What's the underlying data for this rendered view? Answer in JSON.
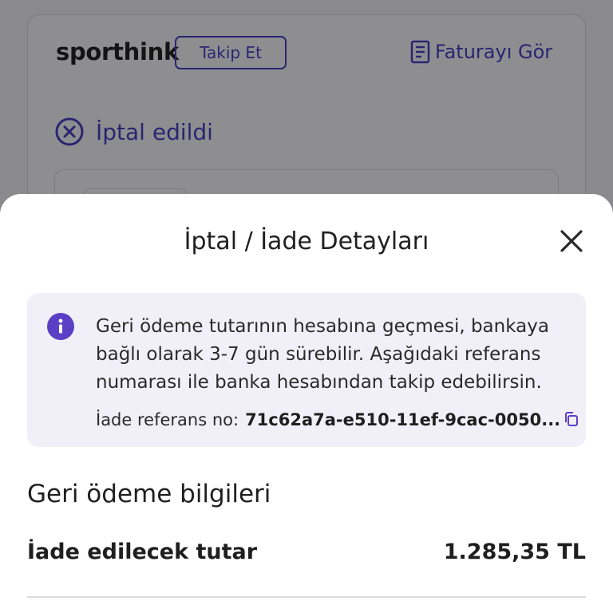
{
  "background": {
    "store_name": "sporthink",
    "follow_label": "Takip Et",
    "invoice_label": "Faturayı Gör",
    "status_text": "İptal edildi"
  },
  "sheet": {
    "title": "İptal / İade Detayları",
    "info": {
      "message": "Geri ödeme tutarının hesabına geçmesi, bankaya bağlı olarak 3-7 gün sürebilir. Aşağıdaki referans numarası ile banka hesabından takip edebilirsin.",
      "ref_label": "İade referans no:",
      "ref_value": "71c62a7a-e510-11ef-9cac-0050..."
    },
    "section_title": "Geri ödeme bilgileri",
    "amount_label": "İade edilecek tutar",
    "amount_value": "1.285,35 TL"
  },
  "colors": {
    "accent": "#2c2470",
    "info_icon": "#5b3fc4",
    "info_bg": "#f1f0f8",
    "overlay": "#8a8a8d"
  },
  "icons": {
    "invoice": "document-icon",
    "status": "cancel-circle-icon",
    "close": "close-icon",
    "info": "info-icon",
    "copy": "copy-icon"
  }
}
